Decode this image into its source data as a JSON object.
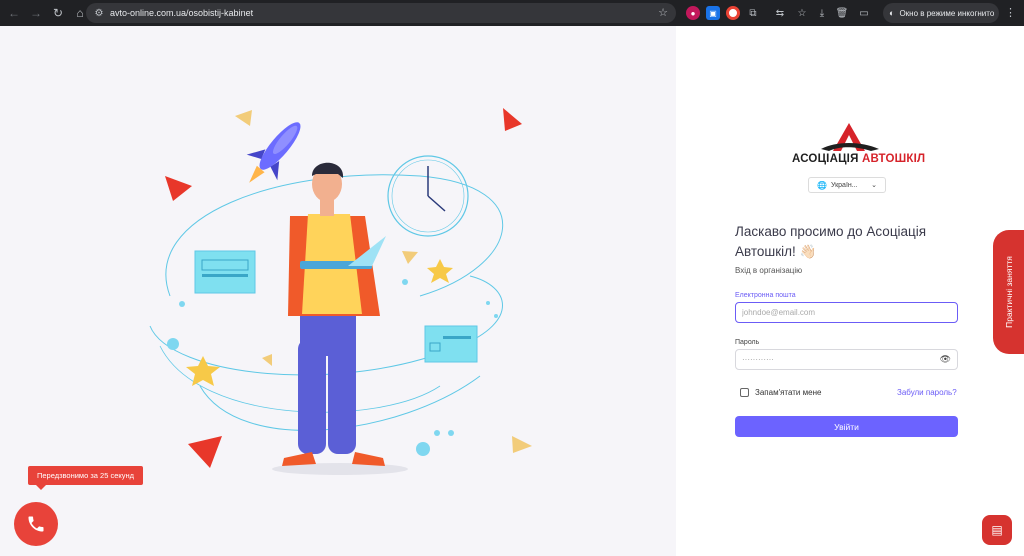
{
  "browser": {
    "url": "avto-online.com.ua/osobistij-kabinet",
    "incognito_label": "Окно в режиме инкогнито"
  },
  "brand": {
    "name_part1": "АСОЦІАЦІЯ ",
    "name_part2": "АВТОШКІЛ",
    "accent_color": "#d6232a"
  },
  "language": {
    "selected": "Україн..."
  },
  "login": {
    "welcome": "Ласкаво просимо до Асоціація Автошкіл! 👋🏻",
    "subtitle": "Вхід в організацію",
    "email_label": "Електронна пошта",
    "email_placeholder": "johndoe@email.com",
    "password_label": "Пароль",
    "password_masked": "············",
    "remember_label": "Запам'ятати мене",
    "forgot_label": "Забули пароль?",
    "submit_label": "Увійти",
    "primary_color": "#6c63ff"
  },
  "side_tab": {
    "label": "Практичні заняття"
  },
  "callback": {
    "tooltip": "Передзвонимо за 25 секунд"
  }
}
